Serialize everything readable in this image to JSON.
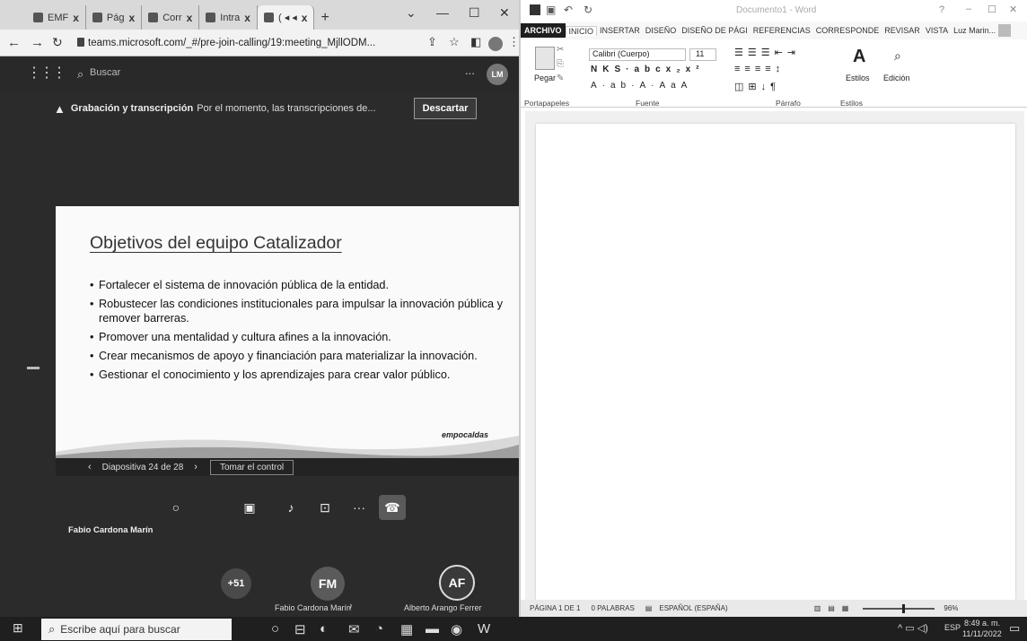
{
  "browser": {
    "tabs": [
      {
        "label": "EMF"
      },
      {
        "label": "Pág"
      },
      {
        "label": "Corr"
      },
      {
        "label": "Intra"
      },
      {
        "label": "( ◂ ◂"
      }
    ],
    "new_tab": "+",
    "url": "teams.microsoft.com/_#/pre-join-calling/19:meeting_MjllODM...",
    "tab_close": "x"
  },
  "teams": {
    "search_placeholder": "Buscar",
    "more": "...",
    "user_initials": "LM",
    "notice_title": "Grabación y transcripción",
    "notice_text": "Por el momento, las transcripciones de...",
    "dismiss": "Descartar",
    "slide": {
      "title": "Objetivos del equipo Catalizador",
      "bullets": [
        "Fortalecer el sistema de innovación pública de la entidad.",
        "Robustecer las condiciones institucionales para impulsar la innovación pública y remover barreras.",
        "Promover una mentalidad y cultura afines a la innovación.",
        "Crear mecanismos de apoyo y financiación para materializar la innovación.",
        "Gestionar el conocimiento y los aprendizajes para crear valor público."
      ],
      "logo_text": "empocaldas"
    },
    "slide_counter": "Diapositiva 24 de 28",
    "take_control": "Tomar el control",
    "presenter": "Fabio Cardona Marín",
    "participants": [
      {
        "initials": "+51",
        "name": ""
      },
      {
        "initials": "FM",
        "name": "Fabio Cardona Marín"
      },
      {
        "initials": "AF",
        "name": "Alberto Arango Ferrer"
      }
    ]
  },
  "word": {
    "title": "Documento1 - Word",
    "help": "?",
    "tabs": [
      "ARCHIVO",
      "INICIO",
      "INSERTAR",
      "DISEÑO",
      "DISEÑO DE PÁGI",
      "REFERENCIAS",
      "CORRESPONDE",
      "REVISAR",
      "VISTA"
    ],
    "user": "Luz Marin...",
    "font_name": "Calibri (Cuerpo)",
    "font_size": "11",
    "paste": "Pegar",
    "styles": "Estilos",
    "editing": "Edición",
    "groups": [
      "Portapapeles",
      "Fuente",
      "Párrafo",
      "Estilos"
    ],
    "status": {
      "page": "PÁGINA 1 DE 1",
      "words": "0 PALABRAS",
      "lang": "ESPAÑOL (ESPAÑA)",
      "zoom": "96%"
    }
  },
  "taskbar": {
    "search_placeholder": "Escribe aquí para buscar",
    "lang": "ESP",
    "time": "8:49 a. m.",
    "date": "11/11/2022"
  }
}
